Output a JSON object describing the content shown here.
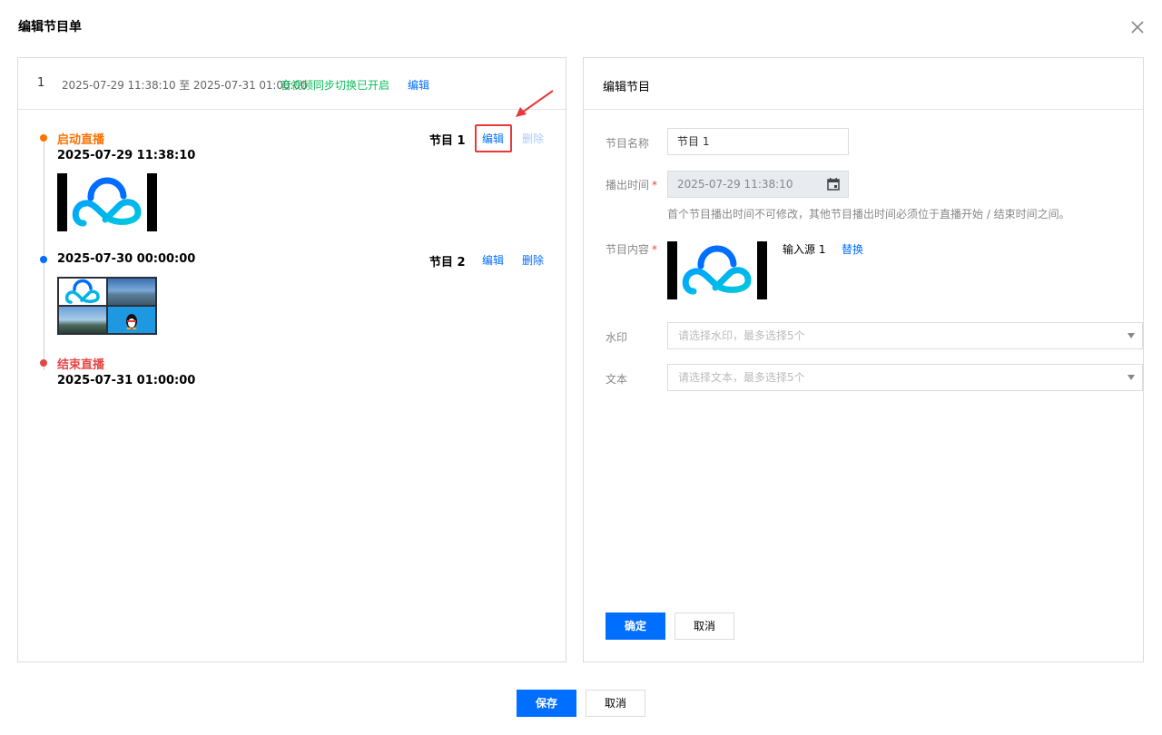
{
  "dialog": {
    "title": "编辑节目单"
  },
  "schedule": {
    "index": "1",
    "range": "2025-07-29 11:38:10 至 2025-07-31 01:00:00",
    "sync_status": "音视频同步切换已开启",
    "edit_label": "编辑"
  },
  "timeline": {
    "start_label": "启动直播",
    "start_time": "2025-07-29 11:38:10",
    "programs": [
      {
        "name": "节目 1",
        "time": "2025-07-29 11:38:10",
        "edit": "编辑",
        "delete": "删除",
        "delete_disabled": true
      },
      {
        "name": "节目 2",
        "time": "2025-07-30 00:00:00",
        "edit": "编辑",
        "delete": "删除",
        "delete_disabled": false
      }
    ],
    "end_label": "结束直播",
    "end_time": "2025-07-31 01:00:00"
  },
  "editor": {
    "title": "编辑节目",
    "name_label": "节目名称",
    "name_value": "节目 1",
    "time_label": "播出时间",
    "time_value": "2025-07-29 11:38:10",
    "time_hint": "首个节目播出时间不可修改，其他节目播出时间必须位于直播开始 / 结束时间之间。",
    "content_label": "节目内容",
    "source_name": "输入源 1",
    "replace_label": "替换",
    "watermark_label": "水印",
    "watermark_placeholder": "请选择水印，最多选择5个",
    "text_label": "文本",
    "text_placeholder": "请选择文本，最多选择5个",
    "confirm": "确定",
    "cancel": "取消"
  },
  "footer": {
    "save": "保存",
    "cancel": "取消"
  },
  "colors": {
    "primary": "#006eff",
    "start": "#ff7200",
    "end": "#e54545",
    "sync": "#0abf5b",
    "highlight": "#e8393b"
  }
}
